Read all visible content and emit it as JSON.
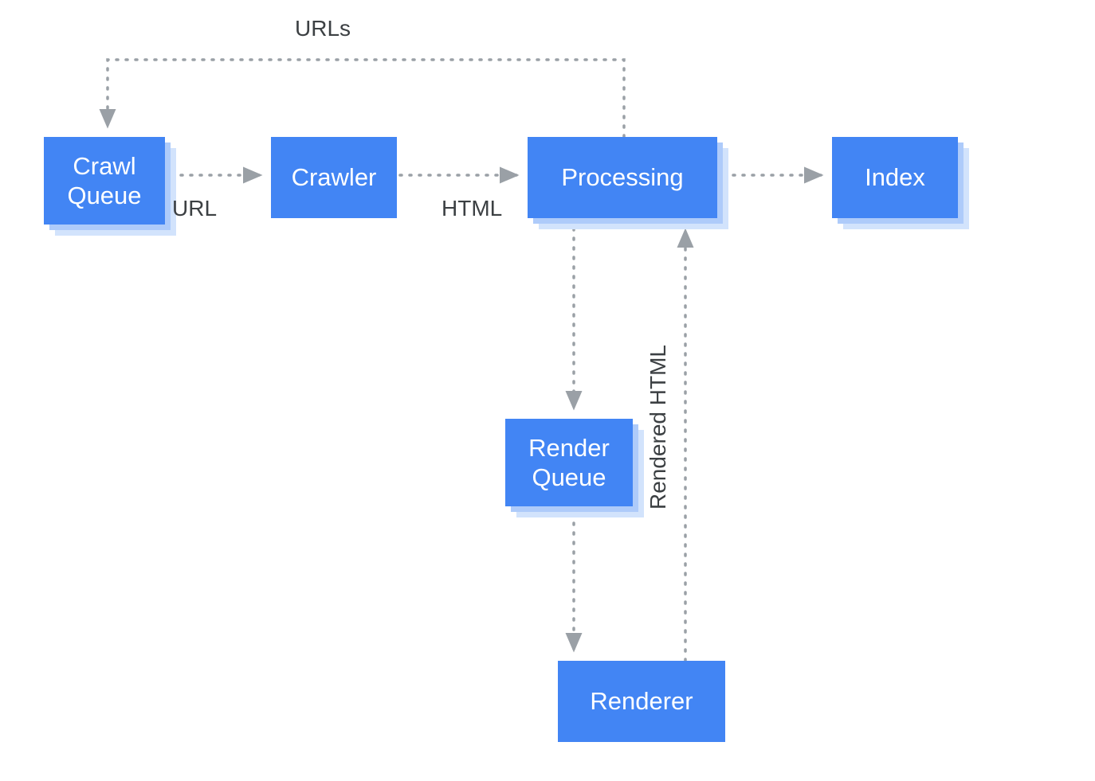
{
  "diagram": {
    "nodes": {
      "crawl_queue": "Crawl\nQueue",
      "crawler": "Crawler",
      "processing": "Processing",
      "index": "Index",
      "render_queue": "Render\nQueue",
      "renderer": "Renderer"
    },
    "edge_labels": {
      "urls": "URLs",
      "url": "URL",
      "html": "HTML",
      "rendered_html": "Rendered HTML"
    },
    "colors": {
      "node_fill": "#4285f4",
      "node_shadow_light": "#d2e3fc",
      "node_shadow_dark": "#aecbfa",
      "connector": "#9aa0a6",
      "label_text": "#3c4043",
      "node_text": "#ffffff"
    }
  }
}
